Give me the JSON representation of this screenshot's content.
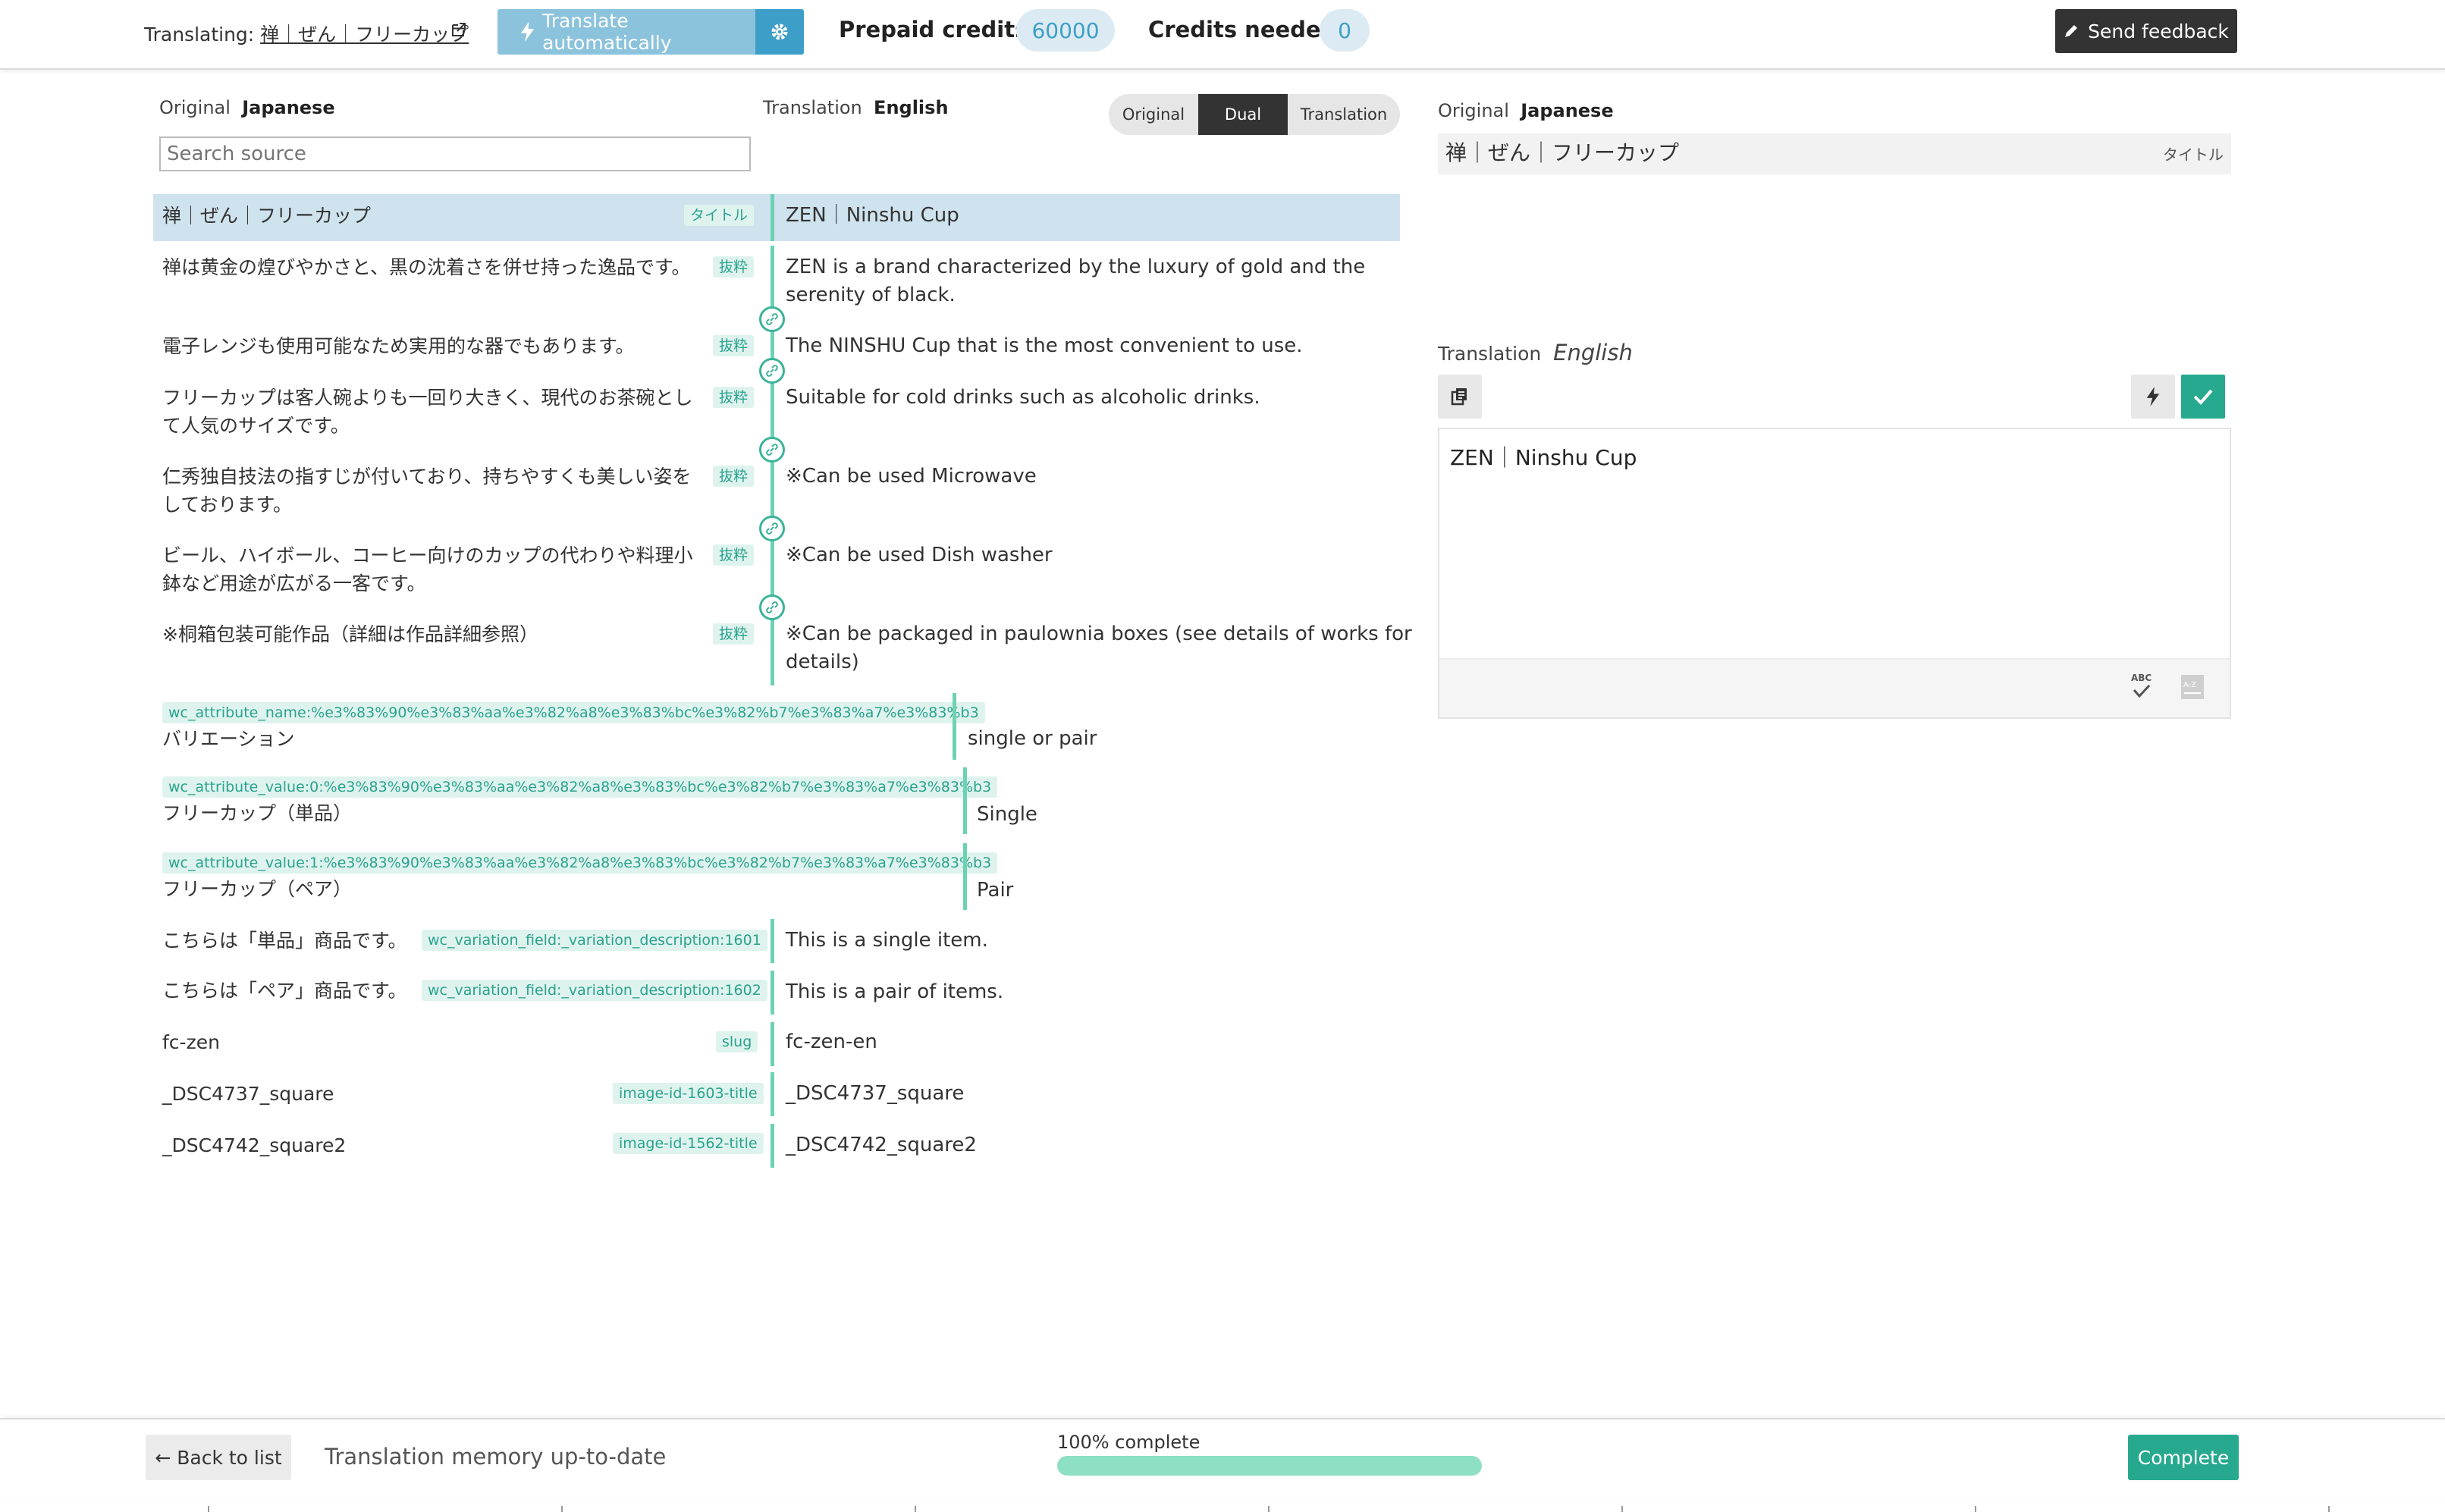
{
  "header": {
    "translating_prefix": "Translating:",
    "translating_link": "禅｜ぜん｜フリーカップ",
    "translate_auto_label": "Translate automatically",
    "prepaid_label": "Prepaid credits:",
    "prepaid_value": "60000",
    "needed_label": "Credits needed",
    "needed_value": "0",
    "feedback_label": "Send feedback"
  },
  "columns": {
    "original_prefix": "Original",
    "original_lang": "Japanese",
    "translation_prefix": "Translation",
    "translation_lang": "English",
    "search_placeholder": "Search source"
  },
  "view_toggle": {
    "original": "Original",
    "dual": "Dual",
    "translation": "Translation",
    "selected": "Dual"
  },
  "rows": [
    {
      "source": "禅｜ぜん｜フリーカップ",
      "tag": "タイトル",
      "target": "ZEN｜Ninshu Cup"
    },
    {
      "source": "禅は黄金の煌びやかさと、黒の沈着さを併せ持った逸品です。",
      "tag": "抜粋",
      "target_lines": [
        "ZEN is a brand characterized by the luxury of gold and the",
        "serenity of black."
      ]
    },
    {
      "source": "電子レンジも使用可能なため実用的な器でもあります。",
      "tag": "抜粋",
      "target": "The NINSHU Cup that is the most convenient to use."
    },
    {
      "source_lines": [
        "フリーカップは客人碗よりも一回り大きく、現代のお茶碗とし",
        "て人気のサイズです。"
      ],
      "tag": "抜粋",
      "target": "Suitable for cold drinks such as alcoholic drinks."
    },
    {
      "source_lines": [
        "仁秀独自技法の指すじが付いており、持ちやすくも美しい姿を",
        "しております。"
      ],
      "tag": "抜粋",
      "target": "※Can be used Microwave"
    },
    {
      "source_lines": [
        "ビール、ハイボール、コーヒー向けのカップの代わりや料理小",
        "鉢など用途が広がる一客です。"
      ],
      "tag": "抜粋",
      "target": "※Can be used Dish washer"
    },
    {
      "source": "※桐箱包装可能作品（詳細は作品詳細参照）",
      "tag": "抜粋",
      "target_lines": [
        "※Can be packaged in paulownia boxes (see details of works for",
        "details)"
      ]
    },
    {
      "source": "バリエーション",
      "tag": "wc_attribute_name:%e3%83%90%e3%83%aa%e3%82%a8%e3%83%bc%e3%82%b7%e3%83%a7%e3%83%b3",
      "target": "single or pair"
    },
    {
      "source": "フリーカップ（単品）",
      "tag": "wc_attribute_value:0:%e3%83%90%e3%83%aa%e3%82%a8%e3%83%bc%e3%82%b7%e3%83%a7%e3%83%b3",
      "target": "Single"
    },
    {
      "source": "フリーカップ（ペア）",
      "tag": "wc_attribute_value:1:%e3%83%90%e3%83%aa%e3%82%a8%e3%83%bc%e3%82%b7%e3%83%a7%e3%83%b3",
      "target": "Pair"
    },
    {
      "source": "こちらは「単品」商品です。",
      "tag": "wc_variation_field:_variation_description:1601",
      "target": "This is a single item."
    },
    {
      "source": "こちらは「ペア」商品です。",
      "tag": "wc_variation_field:_variation_description:1602",
      "target": "This is a pair of items."
    },
    {
      "source": "fc-zen",
      "tag": "slug",
      "target": "fc-zen-en"
    },
    {
      "source": "_DSC4737_square",
      "tag": "image-id-1603-title",
      "target": "_DSC4737_square"
    },
    {
      "source": "_DSC4742_square2",
      "tag": "image-id-1562-title",
      "target": "_DSC4742_square2"
    }
  ],
  "panel": {
    "original_prefix": "Original",
    "original_lang": "Japanese",
    "original_text": "禅｜ぜん｜フリーカップ",
    "original_tag": "タイトル",
    "translation_prefix": "Translation",
    "translation_lang": "English",
    "editor_text": "ZEN｜Ninshu Cup"
  },
  "footer": {
    "back_label": "← Back to list",
    "memory_status": "Translation memory up-to-date",
    "progress_label": "100% complete",
    "progress_fraction": 1.0,
    "complete_label": "Complete"
  },
  "colors": {
    "accent_blue": "#3d9fc7",
    "accent_green": "#27a98f",
    "selected_row": "#cfe3ee"
  }
}
